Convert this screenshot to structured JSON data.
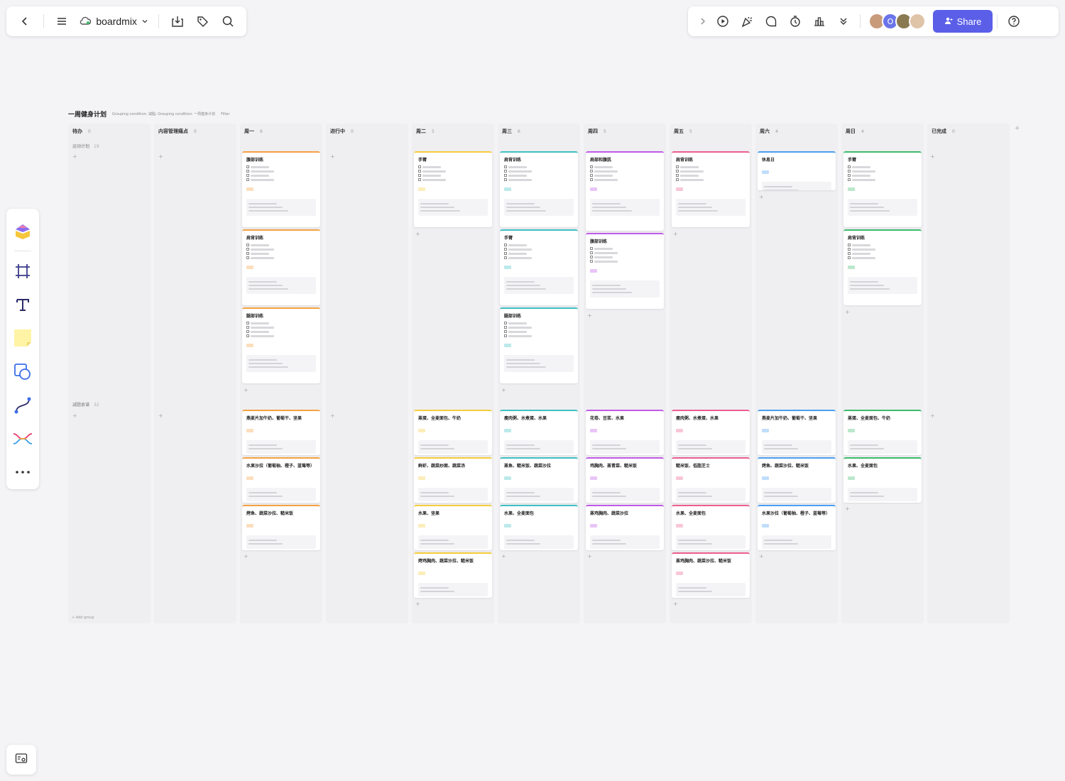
{
  "app": {
    "name": "boardmix",
    "share_label": "Share",
    "accent": "#5b5fe8"
  },
  "board": {
    "title": "一周健身计划",
    "condition": "Grouping condition: 减脂; Grouping condition: 一周健身计划",
    "filter": "Filter"
  },
  "columns": [
    {
      "name": "待办",
      "count": "0"
    },
    {
      "name": "内容管理痛点",
      "count": "0"
    },
    {
      "name": "周一",
      "count": "6"
    },
    {
      "name": "进行中",
      "count": "0"
    },
    {
      "name": "周二",
      "count": "5"
    },
    {
      "name": "周三",
      "count": "6"
    },
    {
      "name": "周四",
      "count": "5"
    },
    {
      "name": "周五",
      "count": "5"
    },
    {
      "name": "周六",
      "count": "4"
    },
    {
      "name": "周日",
      "count": "4"
    },
    {
      "name": "已完成",
      "count": "0"
    }
  ],
  "groups": [
    {
      "name": "运动计划",
      "count": "19"
    },
    {
      "name": "减脂食谱",
      "count": "32"
    }
  ],
  "add_group": "+ Add group",
  "colors": {
    "mon": "#f5a142",
    "tue": "#f5cc3d",
    "wed": "#3fbfc4",
    "thu": "#c15ae8",
    "fri": "#ec5d90",
    "sat": "#4a9ff0",
    "sun": "#3dbb6c"
  },
  "cards": {
    "mon_ex": [
      "腹部训练",
      "肩背训练",
      "腿部训练"
    ],
    "tue_ex": [
      "手臂"
    ],
    "wed_ex": [
      "肩背训练",
      "手臂",
      "腿部训练"
    ],
    "thu_ex": [
      "肩部和腹肌",
      "腹部训练"
    ],
    "fri_ex": [
      "肩背训练"
    ],
    "sat_ex": [
      "休息日"
    ],
    "sun_ex": [
      "手臂",
      "肩背训练"
    ],
    "mon_diet": [
      "燕麦片加牛奶、葡萄干、坚果",
      "水果沙拉（葡萄柚、橙子、蓝莓等）",
      "烤鱼、蔬菜沙拉、糙米饭"
    ],
    "tue_diet": [
      "蒸蛋、全麦面包、牛奶",
      "鲜虾、蔬菜炒面、蔬菜汤",
      "水果、坚果",
      "烤鸡胸肉、蔬菜沙拉、糙米饭"
    ],
    "wed_diet": [
      "瘦肉粥、水煮蛋、水果",
      "蒸鱼、糙米饭、蔬菜沙拉",
      "水果、全麦面包"
    ],
    "thu_diet": [
      "花卷、豆浆、水果",
      "鸡胸肉、蒸青菜、糙米饭",
      "蒸鸡胸肉、蔬菜沙拉"
    ],
    "fri_diet": [
      "瘦肉粥、水煮蛋、水果",
      "糙米饭、低脂芝士",
      "水果、全麦面包",
      "蒸鸡胸肉、蔬菜沙拉、糙米饭"
    ],
    "sat_diet": [
      "燕麦片加牛奶、葡萄干、坚果",
      "烤鱼、蔬菜沙拉、糙米饭",
      "水果沙拉（葡萄柚、橙子、蓝莓等）"
    ],
    "sun_diet": [
      "蒸蛋、全麦面包、牛奶",
      "水果、全麦面包"
    ]
  },
  "icons": {
    "back": "chevron-left-icon",
    "menu": "menu-icon",
    "cloud": "cloud-icon",
    "download": "download-icon",
    "tag": "tag-icon",
    "search": "search-icon",
    "expand": "chevron-right-icon",
    "play": "play-icon",
    "celebrate": "party-icon",
    "comment": "comment-icon",
    "timer": "timer-icon",
    "vote": "vote-icon",
    "more": "chevron-double-down-icon",
    "help": "help-icon",
    "tools": [
      "templates-icon",
      "frame-icon",
      "text-icon",
      "sticky-note-icon",
      "shape-icon",
      "connector-icon",
      "mindmap-icon",
      "more-icon"
    ],
    "minimap": "minimap-icon"
  }
}
